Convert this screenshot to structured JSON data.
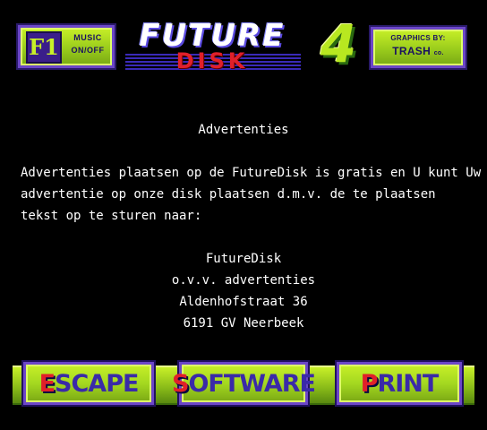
{
  "header": {
    "f1_key": "F1",
    "f1_label_line1": "MUSIC",
    "f1_label_line2": "ON/OFF",
    "logo_word1": "FUTURE",
    "logo_word2": "DISK",
    "logo_issue": "4",
    "credits_line1": "GRAPHICS BY:",
    "credits_line2": "TRASH",
    "credits_suffix": "co."
  },
  "article": {
    "title": "Advertenties",
    "paragraph": [
      "Advertenties plaatsen op de FutureDisk is gratis en U kunt Uw",
      "advertentie op onze disk plaatsen d.m.v. de te plaatsen",
      "tekst op te sturen naar:"
    ],
    "address": [
      "FutureDisk",
      "o.v.v. advertenties",
      "Aldenhofstraat 36",
      "6191 GV Neerbeek"
    ]
  },
  "buttons": {
    "escape": {
      "first": "E",
      "rest": "SCAPE"
    },
    "software": {
      "first": "S",
      "rest": "OFTWARE"
    },
    "print": {
      "first": "P",
      "rest": "RINT"
    }
  },
  "colors": {
    "background": "#000000",
    "text": "#ffffff",
    "panel_green": "#a4d820",
    "panel_border": "#6c46c8",
    "hotkey_red": "#e0202a",
    "button_text": "#3a2aa8"
  }
}
